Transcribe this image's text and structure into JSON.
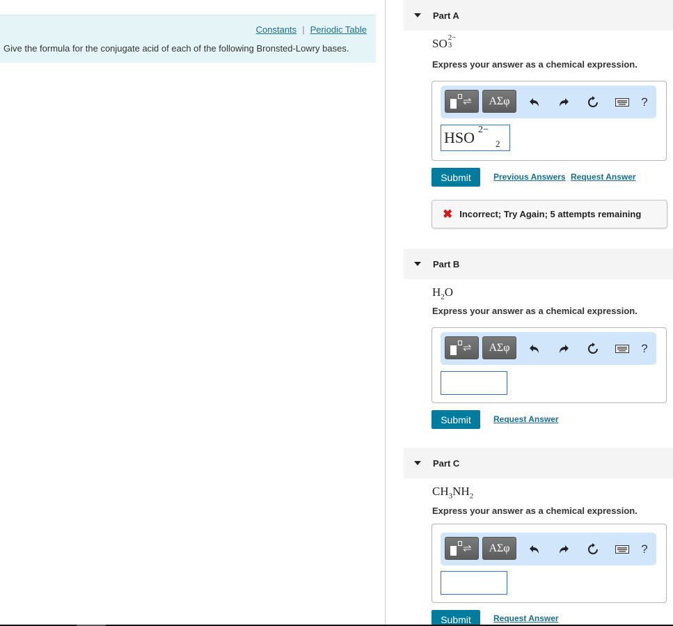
{
  "header": {
    "links": [
      "Constants",
      "Periodic Table"
    ],
    "separator": "|",
    "instructions": "Give the formula for the conjugate acid of each of the following Bronsted-Lowry bases."
  },
  "toolbar": {
    "template_icon": "template-icon",
    "greek_label": "ΑΣφ",
    "undo_icon": "undo-icon",
    "redo_icon": "redo-icon",
    "reset_icon": "reset-icon",
    "keyboard_icon": "keyboard-icon",
    "help_label": "?"
  },
  "parts": [
    {
      "title": "Part A",
      "formula": {
        "base": "SO",
        "sub": "3",
        "sup": "2−"
      },
      "prompt": "Express your answer as a chemical expression.",
      "answer": {
        "main": "HSO",
        "sup": "2−",
        "sub": "2"
      },
      "submit_label": "Submit",
      "links": [
        "Previous Answers",
        "Request Answer"
      ],
      "feedback": {
        "icon": "✖",
        "message": "Incorrect; Try Again; 5 attempts remaining"
      }
    },
    {
      "title": "Part B",
      "formula": {
        "a": "H",
        "a_sub": "2",
        "b": "O"
      },
      "prompt": "Express your answer as a chemical expression.",
      "answer": "",
      "submit_label": "Submit",
      "links": [
        "Request Answer"
      ]
    },
    {
      "title": "Part C",
      "formula": {
        "a": "CH",
        "a_sub": "3",
        "b": "NH",
        "b_sub": "2"
      },
      "prompt": "Express your answer as a chemical expression.",
      "answer": "",
      "submit_label": "Submit",
      "links": [
        "Request Answer"
      ]
    }
  ],
  "colors": {
    "accent": "#007c9e",
    "link": "#1a6e8c",
    "toolbar_bg": "#d1e5fb",
    "error": "#d3171a",
    "info_bg": "#e5f5f7"
  }
}
